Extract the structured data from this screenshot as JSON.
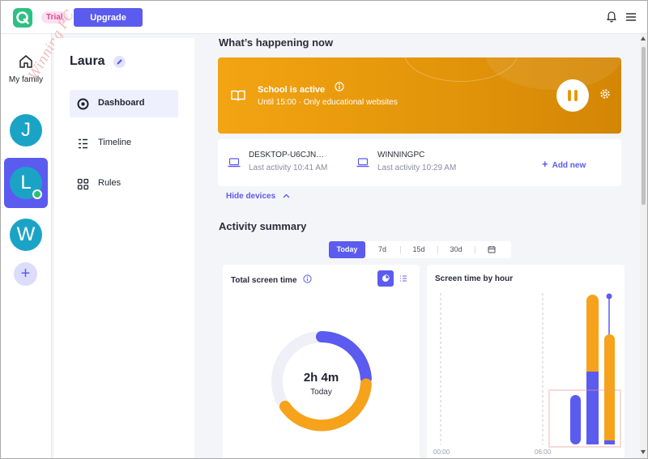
{
  "topbar": {
    "trial_badge": "Trial",
    "upgrade_label": "Upgrade",
    "icons": [
      "logo-icon",
      "bell-icon",
      "menu-icon"
    ]
  },
  "rail": {
    "home_label": "My family",
    "members": [
      {
        "initial": "J",
        "selected": false
      },
      {
        "initial": "L",
        "selected": true,
        "online": true
      },
      {
        "initial": "W",
        "selected": false
      }
    ],
    "add_member_symbol": "+",
    "watermark": "Winning PC"
  },
  "nav": {
    "user_name": "Laura",
    "items": [
      {
        "label": "Dashboard",
        "icon": "target-icon",
        "active": true
      },
      {
        "label": "Timeline",
        "icon": "timeline-icon",
        "active": false
      },
      {
        "label": "Rules",
        "icon": "grid-icon",
        "active": false
      }
    ]
  },
  "main": {
    "happening_title": "What’s happening now",
    "school": {
      "title": "School is active",
      "subtitle": "Until 15:00 · Only educational websites"
    },
    "devices": [
      {
        "name": "DESKTOP-U6CJN…",
        "activity": "Last activity 10:41 AM"
      },
      {
        "name": "WINNINGPC",
        "activity": "Last activity 10:29 AM"
      }
    ],
    "add_new_label": "Add new",
    "hide_devices_label": "Hide devices",
    "activity_title": "Activity summary",
    "ranges": [
      "Today",
      "7d",
      "15d",
      "30d"
    ],
    "active_range": "Today",
    "total_card": {
      "title": "Total screen time",
      "center_value": "2h 4m",
      "center_label": "Today"
    },
    "hour_card": {
      "title": "Screen time by hour",
      "ticks": [
        "00:00",
        "06:00"
      ]
    }
  },
  "colors": {
    "accent": "#5b5bf0",
    "orange": "#f6a21a",
    "teal": "#1ba3c6",
    "green": "#2cc183"
  }
}
